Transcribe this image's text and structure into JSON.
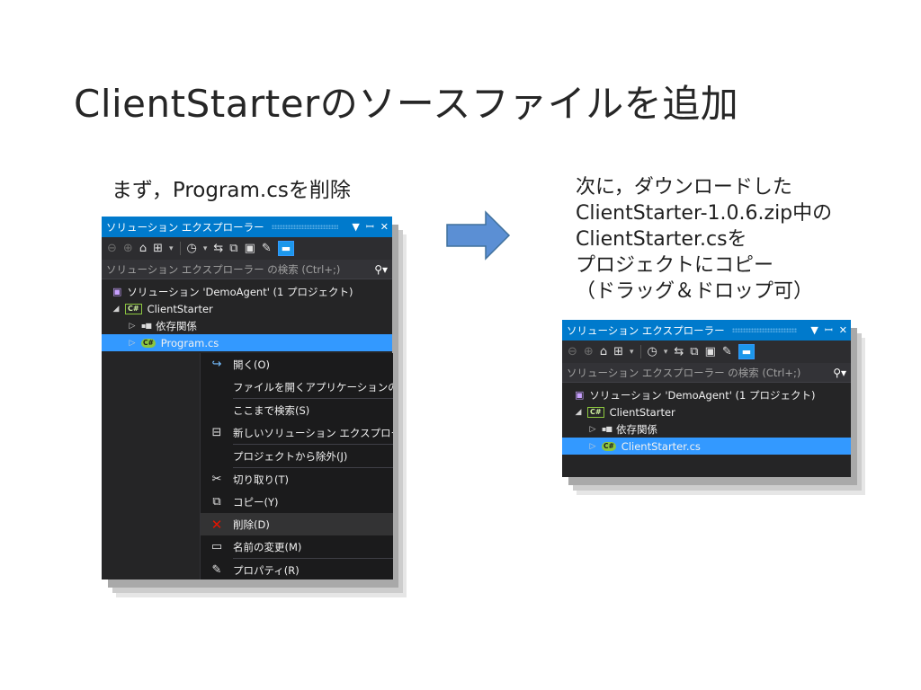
{
  "slide": {
    "title": "ClientStarterのソースファイルを追加",
    "caption_left": "まず，Program.csを削除",
    "caption_right_lines": [
      "次に，ダウンロードした",
      "ClientStarter-1.0.6.zip中の",
      "ClientStarter.csを",
      "プロジェクトにコピー",
      "（ドラッグ＆ドロップ可）"
    ],
    "arrow_color": "#5b8fd4"
  },
  "explorer": {
    "title": "ソリューション エクスプローラー",
    "search_placeholder": "ソリューション エクスプローラー の検索 (Ctrl+;)",
    "accent": "#007acc",
    "selection": "#3399ff"
  },
  "tree_left": {
    "solution": "ソリューション 'DemoAgent' (1 プロジェクト)",
    "project": "ClientStarter",
    "dependencies": "依存関係",
    "file": "Program.cs"
  },
  "tree_right": {
    "solution": "ソリューション 'DemoAgent' (1 プロジェクト)",
    "project": "ClientStarter",
    "dependencies": "依存関係",
    "file": "ClientStarter.cs"
  },
  "context_menu": {
    "open": "開く(O)",
    "open_with": "ファイルを開くアプリケーションの選択",
    "scope_to_this": "ここまで検索(S)",
    "new_view": "新しいソリューション エクスプローラーの",
    "exclude": "プロジェクトから除外(J)",
    "cut": "切り取り(T)",
    "copy": "コピー(Y)",
    "delete": "削除(D)",
    "rename": "名前の変更(M)",
    "properties": "プロパティ(R)"
  }
}
